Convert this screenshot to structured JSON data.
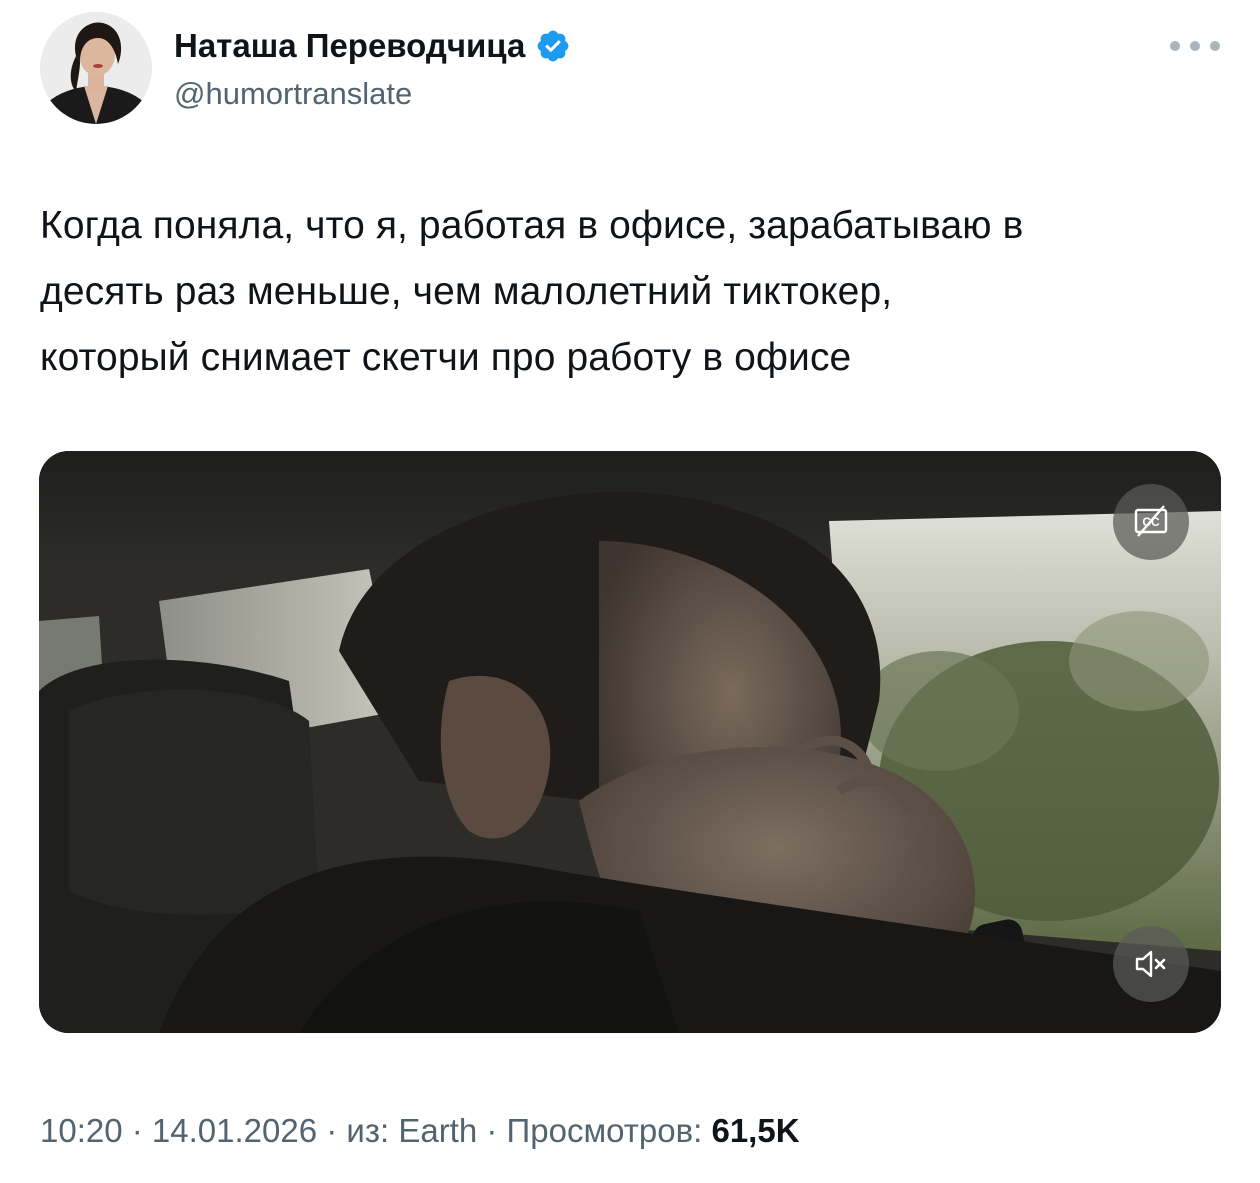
{
  "author": {
    "display_name": "Наташа Переводчица",
    "handle": "@humortranslate",
    "verified": true
  },
  "tweet": {
    "text_lines": [
      "Когда поняла, что я, работая в офисе, зарабатываю в",
      "десять раз меньше, чем малолетний тиктокер,",
      "который снимает скетчи про работу в офисе"
    ]
  },
  "media": {
    "type": "video",
    "controls": [
      "captions-off-icon",
      "volume-muted-icon"
    ]
  },
  "meta": {
    "time": "10:20",
    "separator": " · ",
    "date": "14.01.2026",
    "source_prefix": "из: ",
    "source": "Earth",
    "views_label": "Просмотров: ",
    "views_count": "61,5K"
  },
  "colors": {
    "text_primary": "#0f1419",
    "text_secondary": "#536471",
    "verified_blue": "#1d9bf0"
  }
}
